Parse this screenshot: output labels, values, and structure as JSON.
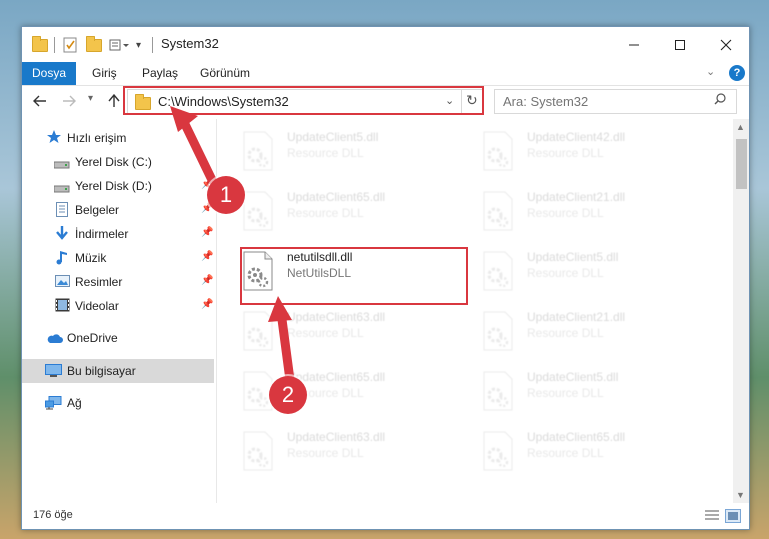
{
  "window": {
    "title": "System32"
  },
  "ribbon": {
    "tabs": [
      "Dosya",
      "Giriş",
      "Paylaş",
      "Görünüm"
    ]
  },
  "address": {
    "path": "C:\\Windows\\System32"
  },
  "search": {
    "placeholder": "Ara: System32"
  },
  "sidebar": {
    "items": [
      {
        "label": "Hızlı erişim",
        "icon": "star-icon"
      },
      {
        "label": "Yerel Disk (C:)",
        "icon": "drive-icon"
      },
      {
        "label": "Yerel Disk (D:)",
        "icon": "drive-icon"
      },
      {
        "label": "Belgeler",
        "icon": "documents-icon"
      },
      {
        "label": "İndirmeler",
        "icon": "download-icon"
      },
      {
        "label": "Müzik",
        "icon": "music-icon"
      },
      {
        "label": "Resimler",
        "icon": "pictures-icon"
      },
      {
        "label": "Videolar",
        "icon": "video-icon"
      },
      {
        "label": "OneDrive",
        "icon": "cloud-icon"
      },
      {
        "label": "Bu bilgisayar",
        "icon": "computer-icon"
      },
      {
        "label": "Ağ",
        "icon": "network-icon"
      }
    ]
  },
  "files": {
    "left": [
      {
        "name": "UpdateClient5.dll",
        "type": "Resource DLL"
      },
      {
        "name": "UpdateClient65.dll",
        "type": "Resource DLL"
      },
      {
        "name": "netutilsdll.dll",
        "type": "NetUtilsDLL"
      },
      {
        "name": "UpdateClient63.dll",
        "type": "Resource DLL"
      },
      {
        "name": "UpdateClient65.dll",
        "type": "Resource DLL"
      },
      {
        "name": "UpdateClient63.dll",
        "type": "Resource DLL"
      }
    ],
    "right": [
      {
        "name": "UpdateClient42.dll",
        "type": "Resource DLL"
      },
      {
        "name": "UpdateClient21.dll",
        "type": "Resource DLL"
      },
      {
        "name": "UpdateClient5.dll",
        "type": "Resource DLL"
      },
      {
        "name": "UpdateClient21.dll",
        "type": "Resource DLL"
      },
      {
        "name": "UpdateClient5.dll",
        "type": "Resource DLL"
      },
      {
        "name": "UpdateClient65.dll",
        "type": "Resource DLL"
      }
    ]
  },
  "status": {
    "item_count": "176 öğe"
  },
  "annotations": {
    "step1": "1",
    "step2": "2"
  },
  "colors": {
    "accent": "#1979ca",
    "highlight": "#d9373f"
  }
}
